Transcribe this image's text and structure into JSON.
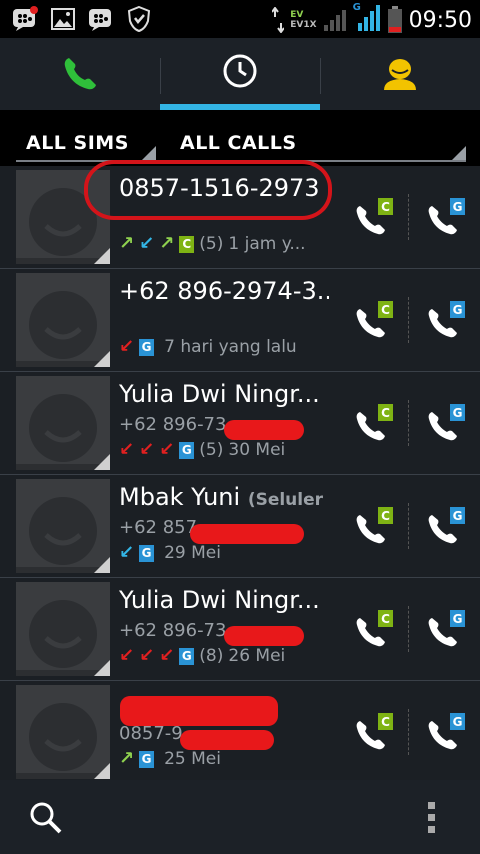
{
  "status_bar": {
    "time": "09:50",
    "network_tag_1": "EV",
    "network_tag_2": "EV1X",
    "sim2_tag": "G",
    "icons": [
      "bbm-notification-icon",
      "gallery-icon",
      "bbm-icon",
      "shield-icon"
    ]
  },
  "tabs": [
    {
      "name": "phone-tab",
      "icon": "phone-icon",
      "selected": false
    },
    {
      "name": "call-log-tab",
      "icon": "clock-icon",
      "selected": true
    },
    {
      "name": "contacts-tab",
      "icon": "person-icon",
      "selected": false
    }
  ],
  "filters": {
    "sims_label": "ALL SIMS",
    "calls_label": "ALL CALLS"
  },
  "calls": [
    {
      "name": "0857-1516-2973",
      "name_suffix": "",
      "number": "",
      "sim": "C",
      "count": "(5)",
      "time": "1 jam y...",
      "directions": [
        "out",
        "in",
        "out"
      ]
    },
    {
      "name": "+62 896-2974-3...",
      "name_suffix": "",
      "number": "",
      "sim": "G",
      "count": "",
      "time": "7 hari yang lalu",
      "directions": [
        "missed"
      ]
    },
    {
      "name": "Yulia Dwi Ningr...",
      "name_suffix": "",
      "number": "+62 896-73",
      "sim": "G",
      "count": "(5)",
      "time": "30 Mei",
      "directions": [
        "missed",
        "missed",
        "missed"
      ]
    },
    {
      "name": "Mbak Yuni ",
      "name_suffix": "(Seluler",
      "number": "+62 857",
      "sim": "G",
      "count": "",
      "time": "29 Mei",
      "directions": [
        "in"
      ]
    },
    {
      "name": "Yulia Dwi Ningr...",
      "name_suffix": "",
      "number": "+62 896-73",
      "sim": "G",
      "count": "(8)",
      "time": "26 Mei",
      "directions": [
        "missed",
        "missed",
        "missed"
      ]
    },
    {
      "name": "",
      "name_suffix": "",
      "number": "0857-9",
      "sim": "G",
      "count": "",
      "time": "25 Mei",
      "directions": [
        "out"
      ]
    }
  ],
  "call_buttons": {
    "sim1": "C",
    "sim2": "G"
  },
  "colors": {
    "accent": "#33b5e5",
    "sim_c": "#7fb314",
    "sim_g": "#2a93d5",
    "missed": "#e02020",
    "incoming": "#33b5e5",
    "outgoing": "#8fd14f",
    "redaction": "#e8181a"
  },
  "bottom_bar": {
    "icons": [
      "search-icon",
      "overflow-menu-icon"
    ]
  }
}
